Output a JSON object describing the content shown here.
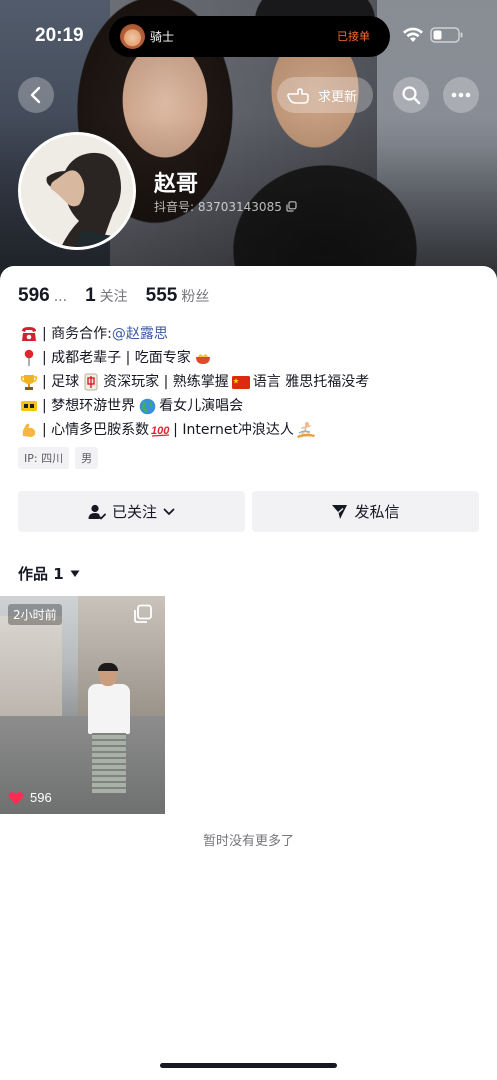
{
  "status_bar": {
    "time": "20:19",
    "island_name": "骑士",
    "island_status": "已接单"
  },
  "header": {
    "update_label": "求更新",
    "profile_name": "赵哥",
    "douyin_id": "抖音号: 83703143085"
  },
  "stats": [
    {
      "num": "596",
      "label": "..."
    },
    {
      "num": "1",
      "label": "关注"
    },
    {
      "num": "555",
      "label": "粉丝"
    }
  ],
  "bio": {
    "line1_prefix": "| 商务合作: ",
    "line1_mention": "@赵露思",
    "line2": "| 成都老辈子 | 吃面专家",
    "line3_a": "| 足球",
    "line3_b": "资深玩家 | 熟练掌握",
    "line3_c": "语言 雅思托福没考",
    "line4_a": "| 梦想环游世界",
    "line4_b": "看女儿演唱会",
    "line5_a": "| 心情多巴胺系数",
    "line5_b": "| Internet冲浪达人"
  },
  "tags": {
    "ip": "IP: 四川",
    "gender": "男"
  },
  "actions": {
    "follow_label": "已关注",
    "message_label": "发私信"
  },
  "works": {
    "tab_label": "作品 1",
    "thumb_time": "2小时前",
    "thumb_likes": "596",
    "no_more": "暂时没有更多了"
  },
  "colors": {
    "mention": "#3a5ba0",
    "like_heart": "#fe2c55",
    "island_status": "#ff6b35"
  }
}
